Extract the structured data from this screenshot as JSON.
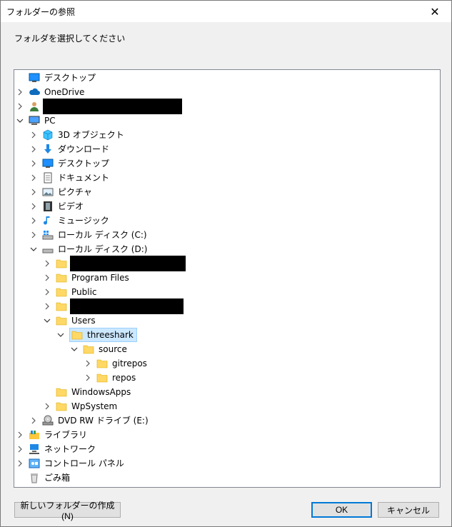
{
  "window": {
    "title": "フォルダーの参照",
    "close_glyph": "✕"
  },
  "prompt": "フォルダを選択してください",
  "tree": [
    {
      "id": "desktop-root",
      "label": "デスクトップ",
      "icon": "desktop-icon",
      "chev": "none"
    },
    {
      "id": "onedrive",
      "label": "OneDrive",
      "icon": "cloud-icon",
      "chev": "right"
    },
    {
      "id": "user-redacted",
      "label": "",
      "icon": "user-icon",
      "chev": "right"
    },
    {
      "id": "pc",
      "label": "PC",
      "icon": "computer-icon",
      "chev": "down"
    },
    {
      "id": "3d",
      "label": "3D オブジェクト",
      "icon": "cube-icon",
      "chev": "right"
    },
    {
      "id": "downloads",
      "label": "ダウンロード",
      "icon": "download-icon",
      "chev": "right"
    },
    {
      "id": "desktop",
      "label": "デスクトップ",
      "icon": "desktop-icon",
      "chev": "right"
    },
    {
      "id": "documents",
      "label": "ドキュメント",
      "icon": "document-icon",
      "chev": "right"
    },
    {
      "id": "pictures",
      "label": "ピクチャ",
      "icon": "picture-icon",
      "chev": "right"
    },
    {
      "id": "videos",
      "label": "ビデオ",
      "icon": "film-icon",
      "chev": "right"
    },
    {
      "id": "music",
      "label": "ミュージック",
      "icon": "music-icon",
      "chev": "right"
    },
    {
      "id": "drive-c",
      "label": "ローカル ディスク (C:)",
      "icon": "windows-drive-icon",
      "chev": "right"
    },
    {
      "id": "drive-d",
      "label": "ローカル ディスク (D:)",
      "icon": "drive-icon",
      "chev": "down"
    },
    {
      "id": "d-redacted-1",
      "label": "",
      "icon": "folder-icon",
      "chev": "right"
    },
    {
      "id": "program-files",
      "label": "Program Files",
      "icon": "folder-icon",
      "chev": "right"
    },
    {
      "id": "public",
      "label": "Public",
      "icon": "folder-icon",
      "chev": "right"
    },
    {
      "id": "d-redacted-2",
      "label": "",
      "icon": "folder-icon",
      "chev": "right"
    },
    {
      "id": "users",
      "label": "Users",
      "icon": "folder-icon",
      "chev": "down"
    },
    {
      "id": "threeshark",
      "label": "threeshark",
      "icon": "folder-icon",
      "chev": "down",
      "selected": true
    },
    {
      "id": "source",
      "label": "source",
      "icon": "folder-icon",
      "chev": "down"
    },
    {
      "id": "gitrepos",
      "label": "gitrepos",
      "icon": "folder-icon",
      "chev": "right"
    },
    {
      "id": "repos",
      "label": "repos",
      "icon": "folder-icon",
      "chev": "right"
    },
    {
      "id": "windowsapps",
      "label": "WindowsApps",
      "icon": "folder-icon",
      "chev": "none"
    },
    {
      "id": "wpsystem",
      "label": "WpSystem",
      "icon": "folder-icon",
      "chev": "right"
    },
    {
      "id": "dvd",
      "label": "DVD RW ドライブ (E:)",
      "icon": "dvd-icon",
      "chev": "right"
    },
    {
      "id": "library",
      "label": "ライブラリ",
      "icon": "library-icon",
      "chev": "right"
    },
    {
      "id": "network",
      "label": "ネットワーク",
      "icon": "network-icon",
      "chev": "right"
    },
    {
      "id": "control-panel",
      "label": "コントロール パネル",
      "icon": "control-panel-icon",
      "chev": "right"
    },
    {
      "id": "recycle-bin",
      "label": "ごみ箱",
      "icon": "recycle-bin-icon",
      "chev": "none"
    }
  ],
  "buttons": {
    "new_folder": "新しいフォルダーの作成(N)",
    "ok": "OK",
    "cancel": "キャンセル"
  },
  "colors": {
    "selection_bg": "#cce8ff",
    "folder": "#ffd866",
    "accent": "#0078d7"
  }
}
